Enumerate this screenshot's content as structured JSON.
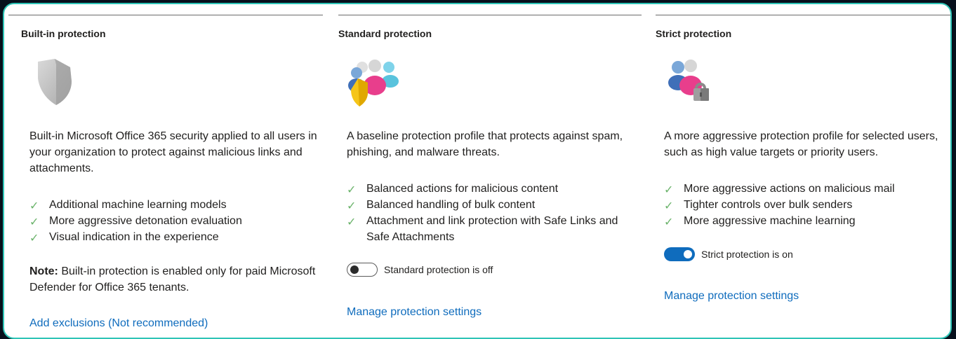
{
  "columns": [
    {
      "title": "Built-in protection",
      "icon": "shield-icon",
      "description": "Built-in Microsoft Office 365 security applied to all users in your organization to protect against malicious links and attachments.",
      "features": [
        "Additional machine learning models",
        "More aggressive detonation evaluation",
        "Visual indication in the experience"
      ],
      "note_label": "Note:",
      "note_text": " Built-in protection is enabled only for paid Microsoft Defender for Office 365 tenants.",
      "link": "Add exclusions (Not recommended)"
    },
    {
      "title": "Standard protection",
      "icon": "users-shield-icon",
      "description": "A baseline protection profile that protects against spam, phishing, and malware threats.",
      "features": [
        "Balanced actions for malicious content",
        "Balanced handling of bulk content",
        "Attachment and link protection with Safe Links and Safe Attachments"
      ],
      "toggle_label": "Standard protection is off",
      "toggle_state": "off",
      "link": "Manage protection settings"
    },
    {
      "title": "Strict protection",
      "icon": "users-lock-icon",
      "description": "A more aggressive protection profile for selected users, such as high value targets or priority users.",
      "features": [
        "More aggressive actions on malicious mail",
        "Tighter controls over bulk senders",
        "More aggressive machine learning"
      ],
      "toggle_label": "Strict protection is on",
      "toggle_state": "on",
      "link": "Manage protection settings"
    }
  ],
  "colors": {
    "frame_border": "#2ec4b6",
    "link": "#0f6cbd",
    "check": "#6bb36b",
    "toggle_on": "#0f6cbd"
  }
}
